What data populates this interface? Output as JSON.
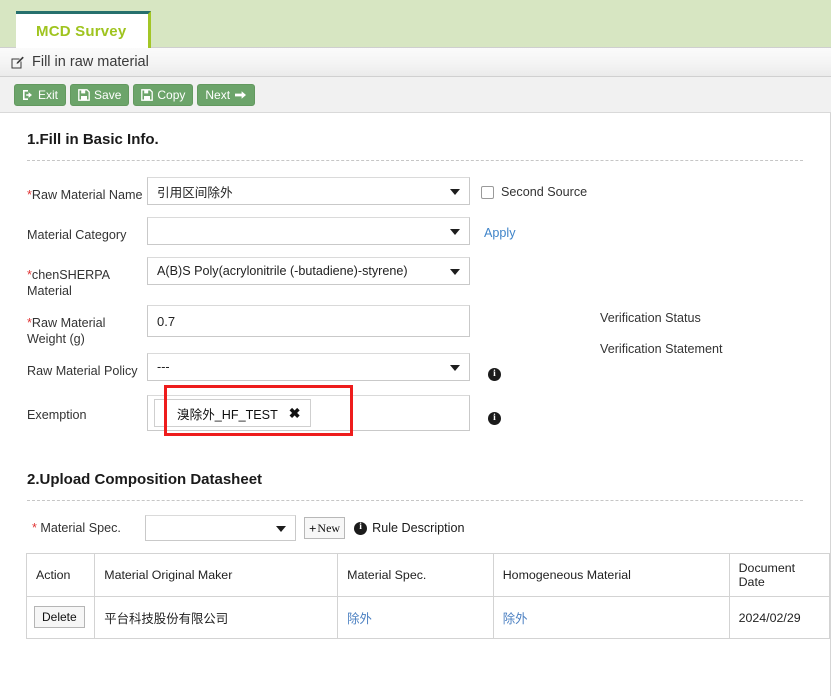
{
  "tab": {
    "label": "MCD Survey"
  },
  "titlebar": {
    "icon": "edit-pencil-square-icon",
    "title": "Fill in raw material"
  },
  "toolbar": {
    "exit_label": "Exit",
    "save_label": "Save",
    "copy_label": "Copy",
    "next_label": "Next"
  },
  "section1": {
    "heading": "1.Fill in Basic Info.",
    "fields": {
      "raw_material_name": {
        "label": "Raw Material Name",
        "required": true,
        "value": "引用区间除外"
      },
      "material_category": {
        "label": "Material Category",
        "required": false,
        "value": ""
      },
      "chensherpa_material": {
        "label": "chenSHERPA Material",
        "required": true,
        "value": "A(B)S Poly(acrylonitrile (-butadiene)-styrene)"
      },
      "raw_material_weight": {
        "label": "Raw Material Weight (g)",
        "required": true,
        "value": "0.7"
      },
      "raw_material_policy": {
        "label": "Raw Material Policy",
        "required": false,
        "value": "---"
      },
      "exemption": {
        "label": "Exemption",
        "required": false,
        "token": "溴除外_HF_TEST",
        "remove_glyph": "✖"
      }
    },
    "second_source": {
      "label": "Second Source",
      "checked": false
    },
    "apply_link": "Apply",
    "verification_status": "Verification Status",
    "verification_statement": "Verification Statement",
    "info_glyph": "i"
  },
  "section2": {
    "heading": "2.Upload Composition Datasheet",
    "material_spec": {
      "label": "Material Spec.",
      "required": true,
      "value": ""
    },
    "new_button": {
      "plus": "+",
      "label": "New"
    },
    "rule_description": "Rule Description",
    "table": {
      "columns": [
        "Action",
        "Material Original Maker",
        "Material Spec.",
        "Homogeneous Material",
        "Document Date"
      ],
      "rows": [
        {
          "action": "Delete",
          "maker": "平台科技股份有限公司",
          "spec": "除外",
          "homogeneous": "除外",
          "date": "2024/02/29"
        }
      ]
    }
  },
  "colors": {
    "tab_strip_bg": "#d7e6c2",
    "tab_text": "#9fc41f",
    "tab_top_border": "#26706d",
    "tab_right_border": "#a3c626",
    "button_green": "#6ca46a",
    "link_blue": "#3f84c9",
    "required_red": "#e03131",
    "highlight_red": "#ee1c1c"
  }
}
